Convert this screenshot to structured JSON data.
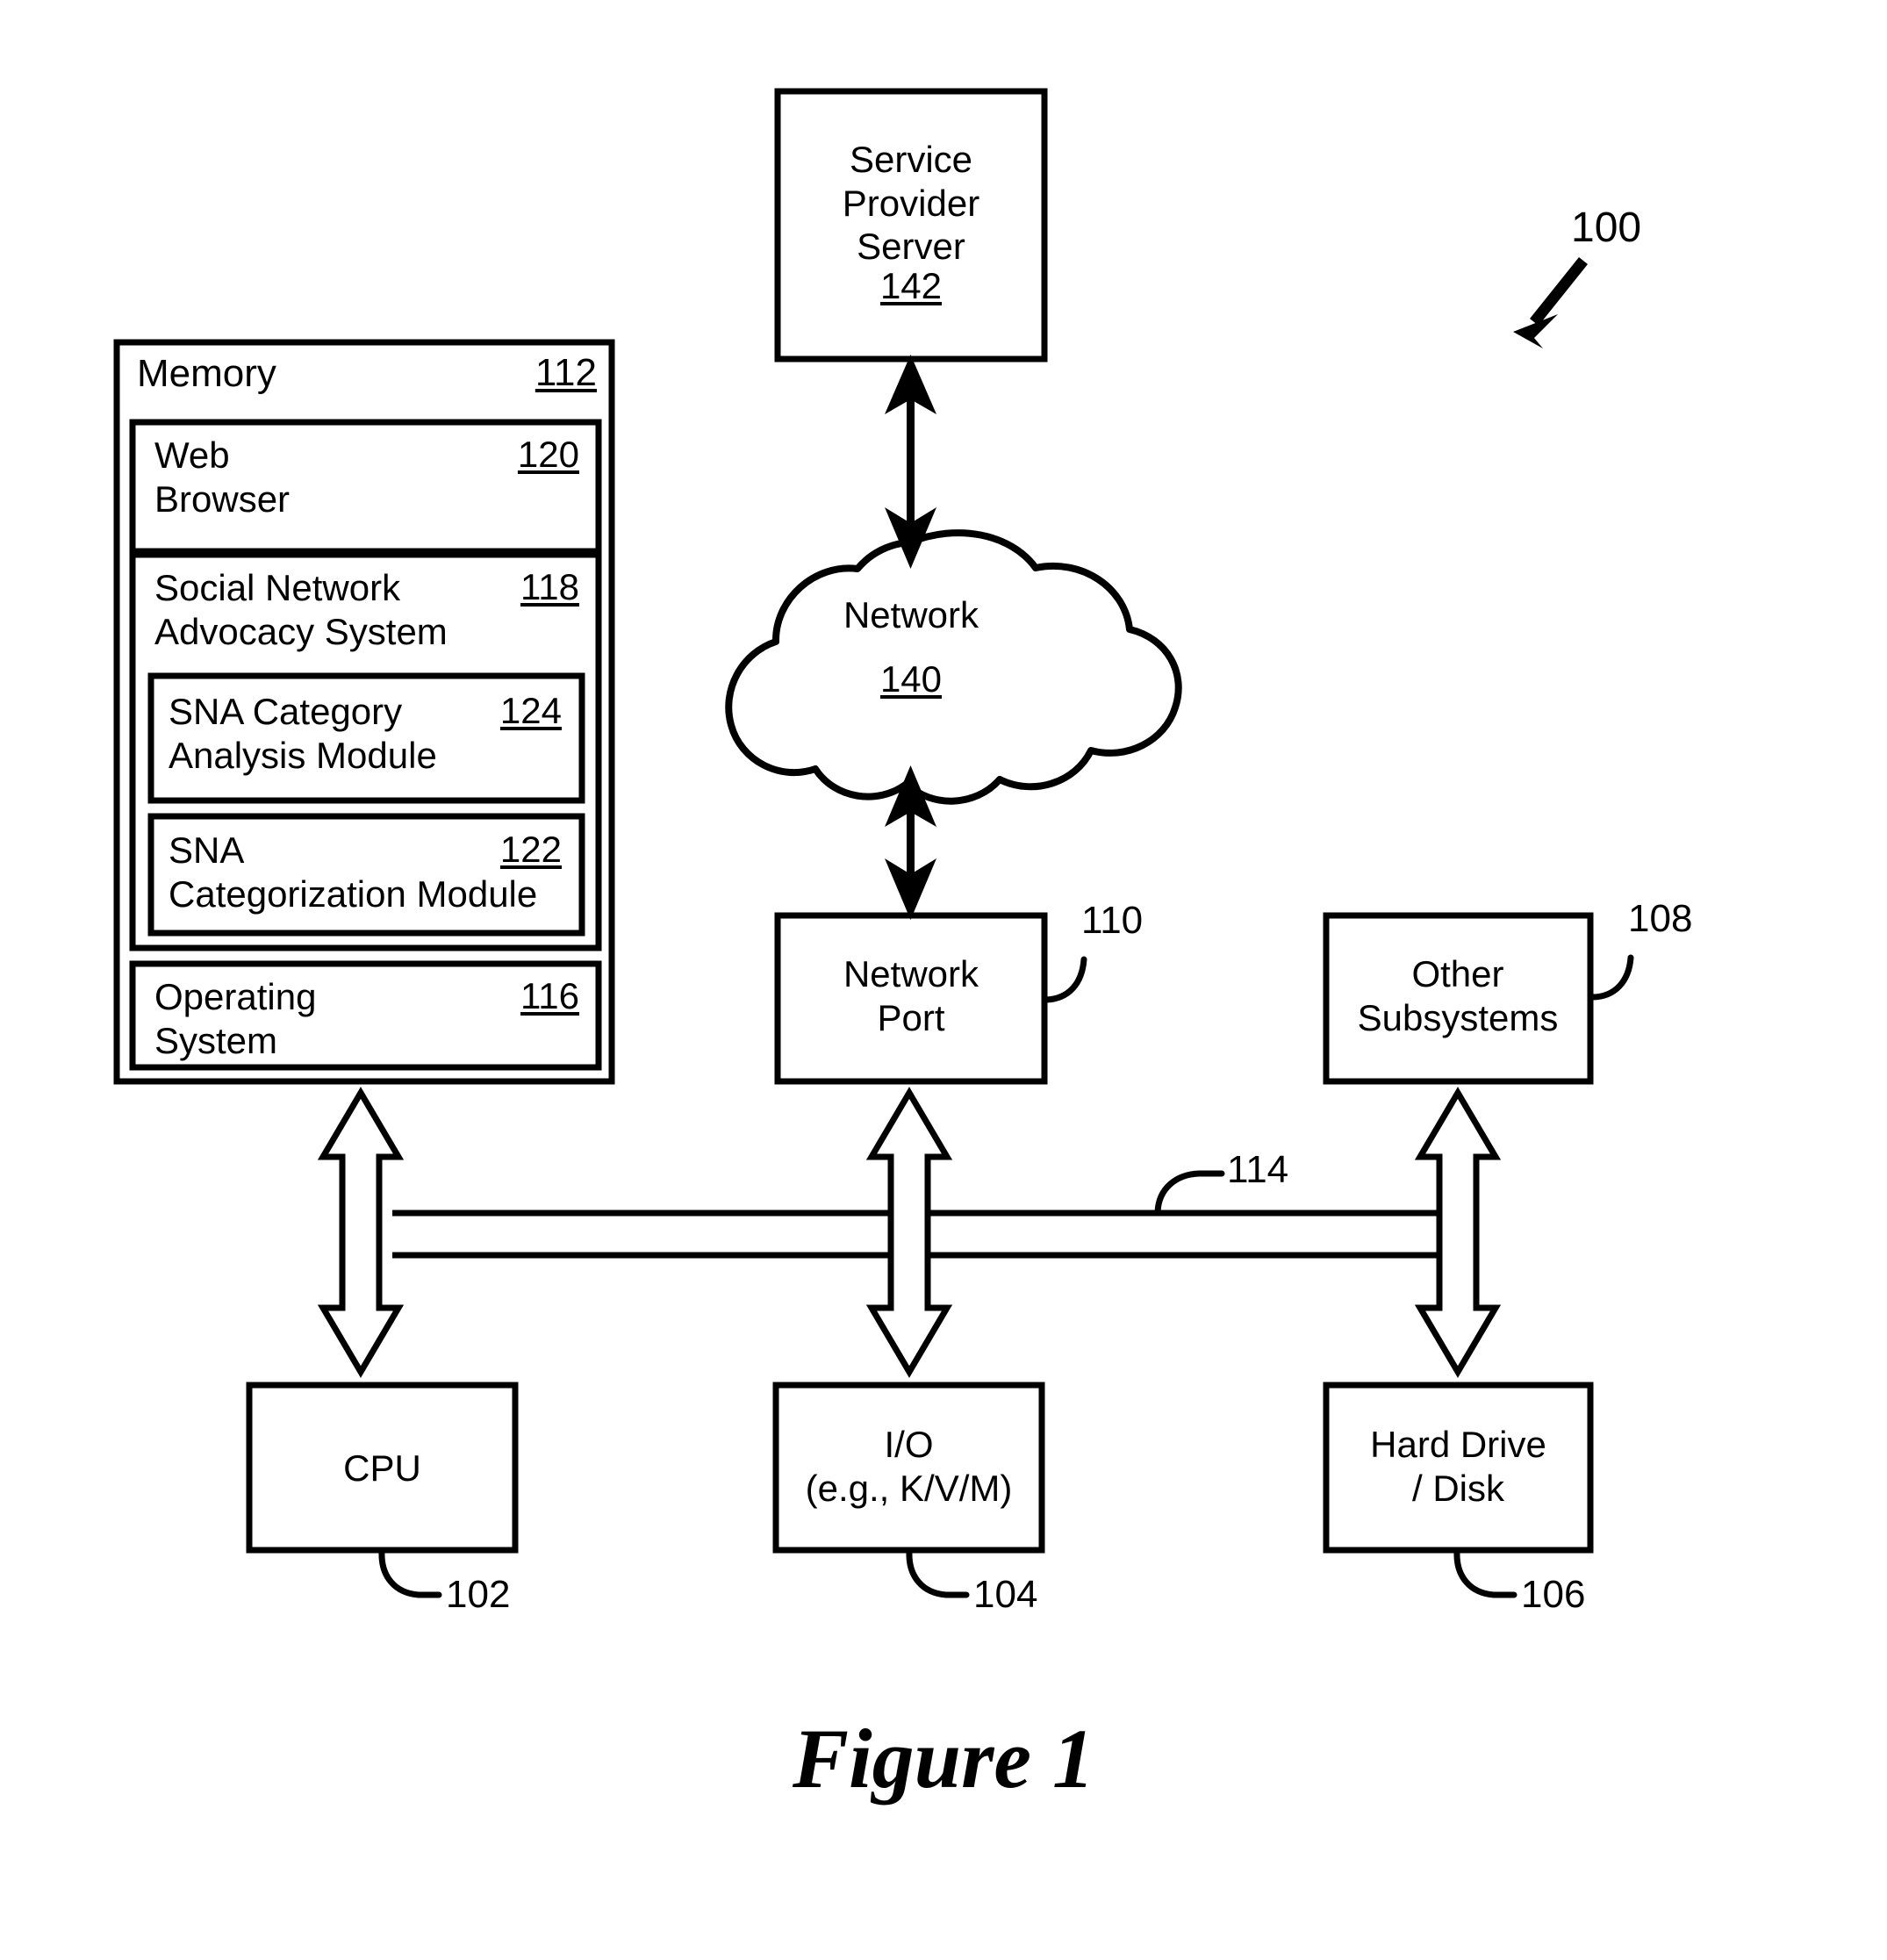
{
  "figure": {
    "caption": "Figure 1",
    "system_ref": "100"
  },
  "memory_block": {
    "title": "Memory",
    "ref": "112",
    "modules": [
      {
        "name": "web-browser",
        "label": "Web\nBrowser",
        "ref": "120"
      },
      {
        "name": "social-network-advocacy-system",
        "label": "Social Network\nAdvocacy System",
        "ref": "118",
        "submodules": [
          {
            "name": "sna-category-analysis-module",
            "label": "SNA Category\nAnalysis Module",
            "ref": "124"
          },
          {
            "name": "sna-categorization-module",
            "label": "SNA\nCategorization Module",
            "ref": "122"
          }
        ]
      },
      {
        "name": "operating-system",
        "label": "Operating\nSystem",
        "ref": "116"
      }
    ]
  },
  "nodes": {
    "service_provider_server": {
      "label": "Service\nProvider\nServer",
      "ref": "142"
    },
    "network": {
      "label": "Network",
      "ref": "140"
    },
    "network_port": {
      "label": "Network\nPort",
      "ref": "110"
    },
    "other_subsystems": {
      "label": "Other\nSubsystems",
      "ref": "108"
    },
    "cpu": {
      "label": "CPU",
      "ref": "102"
    },
    "io": {
      "label": "I/O\n(e.g., K/V/M)",
      "ref": "104"
    },
    "hard_drive": {
      "label": "Hard Drive\n/ Disk",
      "ref": "106"
    },
    "bus": {
      "ref": "114"
    }
  },
  "colors": {
    "stroke": "#000000",
    "fill": "#ffffff",
    "background": "#ffffff"
  }
}
